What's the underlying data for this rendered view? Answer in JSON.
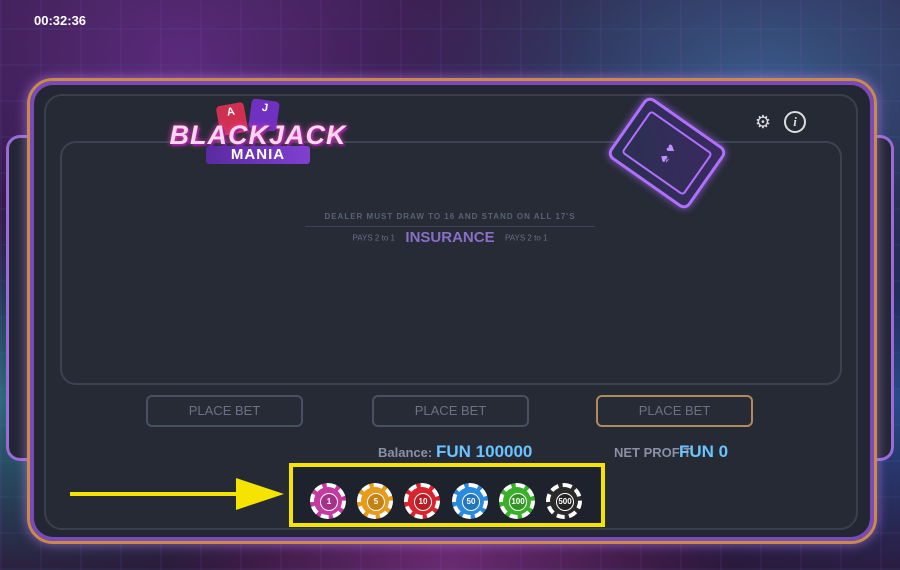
{
  "timer": "00:32:36",
  "logo": {
    "title": "BLACKJACK",
    "subtitle": "MANIA",
    "card_a": "A",
    "card_j": "J"
  },
  "toolbar": {
    "settings_icon": "gear-icon",
    "info_icon": "info-icon",
    "info_glyph": "i"
  },
  "table": {
    "rule_text": "DEALER MUST DRAW TO 16 AND STAND ON ALL 17'S",
    "pays_left": "PAYS 2  to 1",
    "insurance_label": "INSURANCE",
    "pays_right": "PAYS 2  to 1"
  },
  "bets": [
    "PLACE BET",
    "PLACE BET",
    "PLACE BET"
  ],
  "stats": {
    "balance_label": "Balance:",
    "balance_value": "FUN 100000",
    "profit_label": "NET PROFIT",
    "profit_value": "FUN 0"
  },
  "chips": [
    {
      "label": "1",
      "color": "#c43aa0"
    },
    {
      "label": "5",
      "color": "#e89a1a"
    },
    {
      "label": "10",
      "color": "#d8242c"
    },
    {
      "label": "50",
      "color": "#2a8ae0"
    },
    {
      "label": "100",
      "color": "#3ab02a"
    },
    {
      "label": "500",
      "color": "#2a2a2a"
    }
  ],
  "colors": {
    "highlight": "#f5e400",
    "accent": "#6ac4ff",
    "frame": "#9a6ad8"
  }
}
